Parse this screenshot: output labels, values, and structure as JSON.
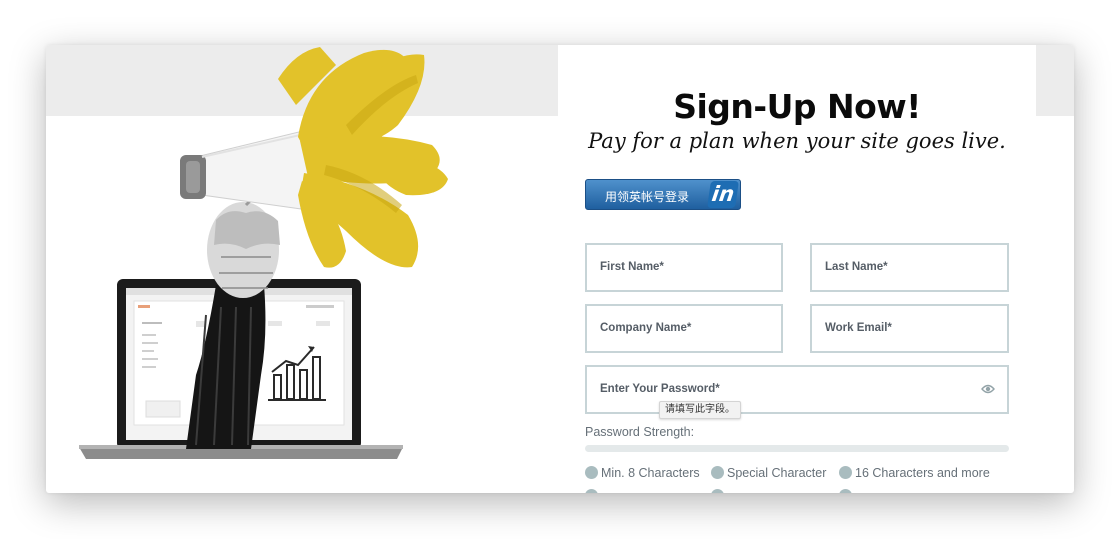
{
  "hero": {
    "title": "Sign-Up Now!",
    "subtitle": "Pay for a plan when your site goes live."
  },
  "linkedin": {
    "label": "用领英帐号登录",
    "badge": "in",
    "color": "#2a6eb5"
  },
  "form": {
    "first_name": "First Name*",
    "last_name": "Last Name*",
    "company_name": "Company Name*",
    "work_email": "Work Email*",
    "password": "Enter Your Password*"
  },
  "tooltip": "请填写此字段。",
  "password_strength": {
    "label": "Password Strength:",
    "level": 0,
    "criteria": [
      "Min. 8 Characters",
      "Special Character",
      "16 Characters and more"
    ]
  },
  "colors": {
    "accent_yellow": "#e2c22a",
    "field_border": "#c7d4d7",
    "criteria_dot": "#a9bcbf"
  },
  "icons": [
    "megaphone-illustration",
    "laptop-illustration",
    "eye-icon"
  ]
}
